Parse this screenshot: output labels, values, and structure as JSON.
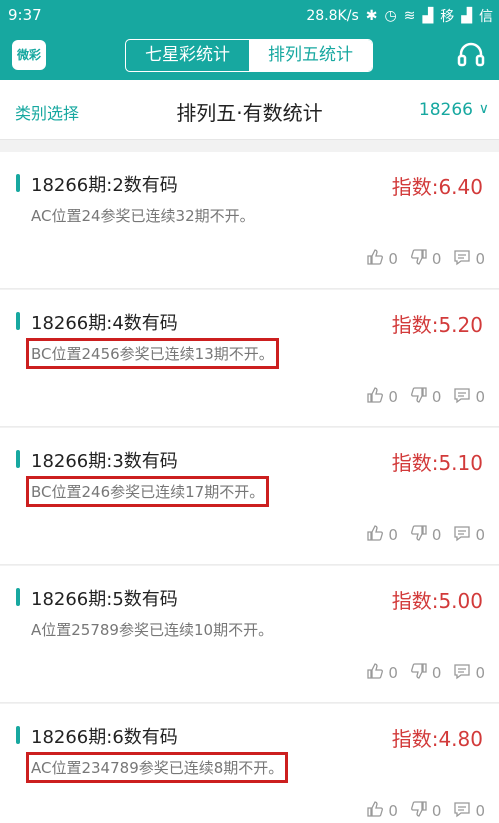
{
  "status": {
    "time": "9:37",
    "speed": "28.8K/s",
    "carrier1": "移",
    "carrier2": "信"
  },
  "header": {
    "logo_text": "微彩",
    "tabs": [
      {
        "label": "七星彩统计",
        "active": false
      },
      {
        "label": "排列五统计",
        "active": true
      }
    ]
  },
  "subbar": {
    "category": "类别选择",
    "title": "排列五·有数统计",
    "issue": "18266"
  },
  "items": [
    {
      "title": "18266期:2数有码",
      "index": "指数:6.40",
      "desc": "AC位置24参奖已连续32期不开。",
      "highlighted": false,
      "likes": "0",
      "dislikes": "0",
      "comments": "0"
    },
    {
      "title": "18266期:4数有码",
      "index": "指数:5.20",
      "desc": "BC位置2456参奖已连续13期不开。",
      "highlighted": true,
      "likes": "0",
      "dislikes": "0",
      "comments": "0"
    },
    {
      "title": "18266期:3数有码",
      "index": "指数:5.10",
      "desc": "BC位置246参奖已连续17期不开。",
      "highlighted": true,
      "likes": "0",
      "dislikes": "0",
      "comments": "0"
    },
    {
      "title": "18266期:5数有码",
      "index": "指数:5.00",
      "desc": "A位置25789参奖已连续10期不开。",
      "highlighted": false,
      "likes": "0",
      "dislikes": "0",
      "comments": "0"
    },
    {
      "title": "18266期:6数有码",
      "index": "指数:4.80",
      "desc": "AC位置234789参奖已连续8期不开。",
      "highlighted": true,
      "likes": "0",
      "dislikes": "0",
      "comments": "0"
    }
  ],
  "colors": {
    "accent": "#17a8a0",
    "index_red": "#d23a3a",
    "highlight_box": "#cc1f1f"
  }
}
